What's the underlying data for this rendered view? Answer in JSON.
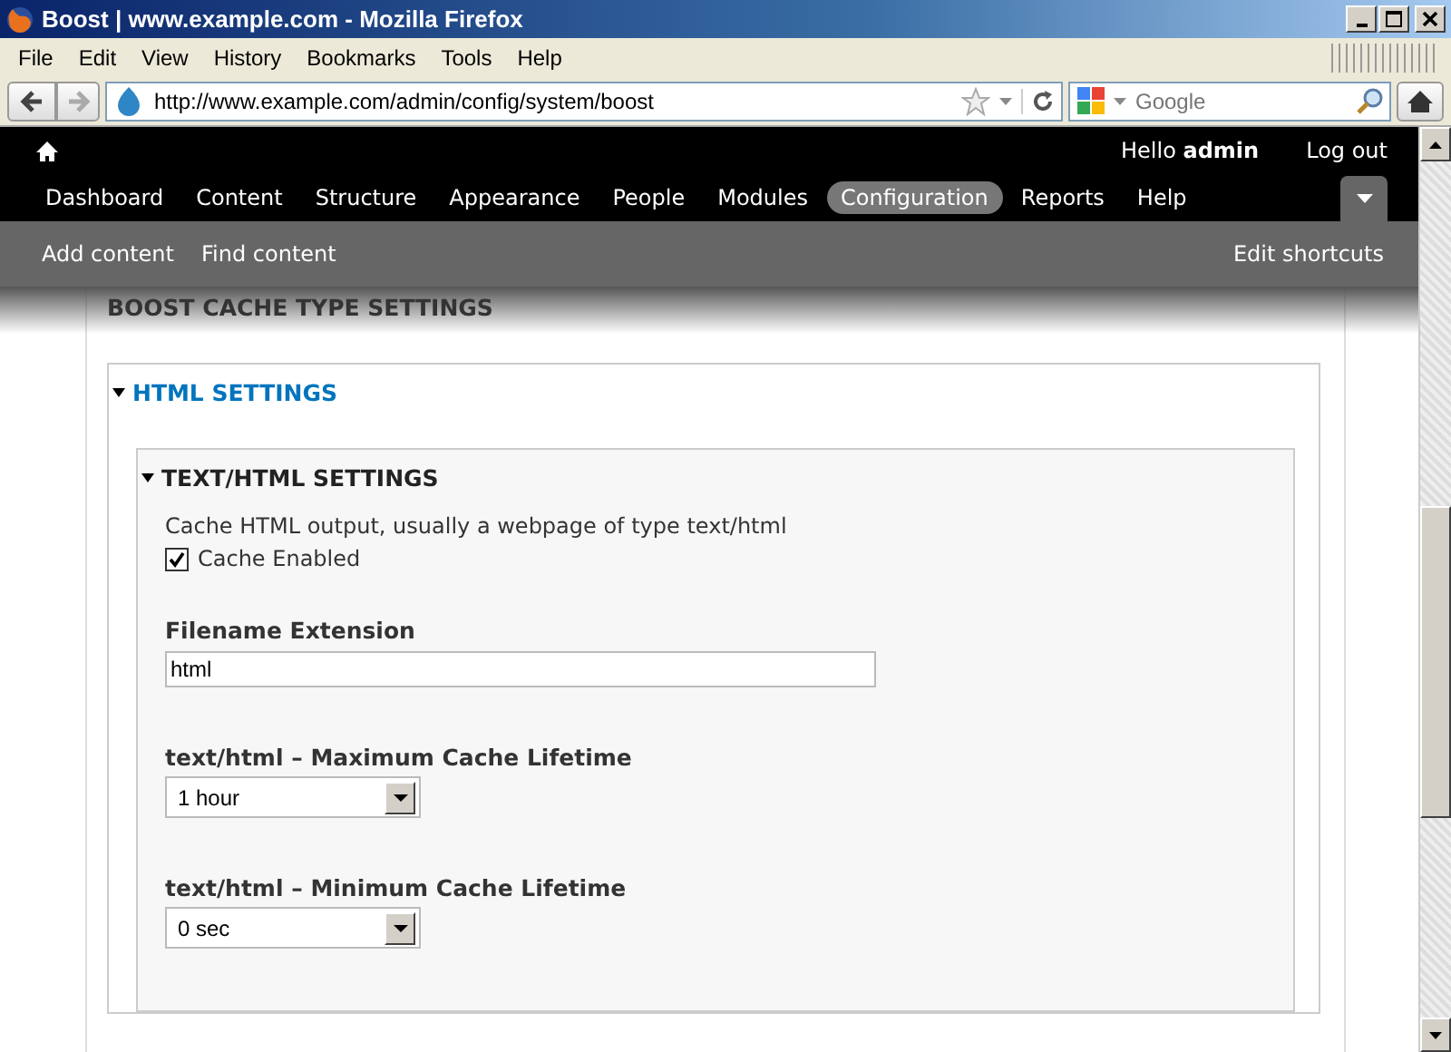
{
  "window": {
    "title": "Boost | www.example.com - Mozilla Firefox"
  },
  "menu": [
    "File",
    "Edit",
    "View",
    "History",
    "Bookmarks",
    "Tools",
    "Help"
  ],
  "address": {
    "value": "http://www.example.com/admin/config/system/boost"
  },
  "search": {
    "placeholder": "Google"
  },
  "toolbar": {
    "greeting": "Hello **admin**",
    "logout": "Log out",
    "nav": [
      {
        "label": "Dashboard",
        "selected": false
      },
      {
        "label": "Content",
        "selected": false
      },
      {
        "label": "Structure",
        "selected": false
      },
      {
        "label": "Appearance",
        "selected": false
      },
      {
        "label": "People",
        "selected": false
      },
      {
        "label": "Modules",
        "selected": false
      },
      {
        "label": "Configuration",
        "selected": true
      },
      {
        "label": "Reports",
        "selected": false
      },
      {
        "label": "Help",
        "selected": false
      }
    ],
    "shortcuts": [
      "Add content",
      "Find content"
    ],
    "edit_shortcuts": "Edit shortcuts"
  },
  "section_title": "BOOST CACHE TYPE SETTINGS",
  "fieldset": {
    "title": "HTML SETTINGS",
    "expanded": true,
    "inner": {
      "title": "TEXT/HTML SETTINGS",
      "expanded": true,
      "description": "Cache HTML output, usually a webpage of type text/html",
      "checkbox": {
        "label": "Cache Enabled",
        "checked": true
      },
      "fields": [
        {
          "kind": "text",
          "label": "Filename Extension",
          "value": "html"
        },
        {
          "kind": "select",
          "label": "text/html – Maximum Cache Lifetime",
          "value": "1 hour"
        },
        {
          "kind": "select",
          "label": "text/html – Minimum Cache Lifetime",
          "value": "0 sec"
        }
      ]
    }
  }
}
